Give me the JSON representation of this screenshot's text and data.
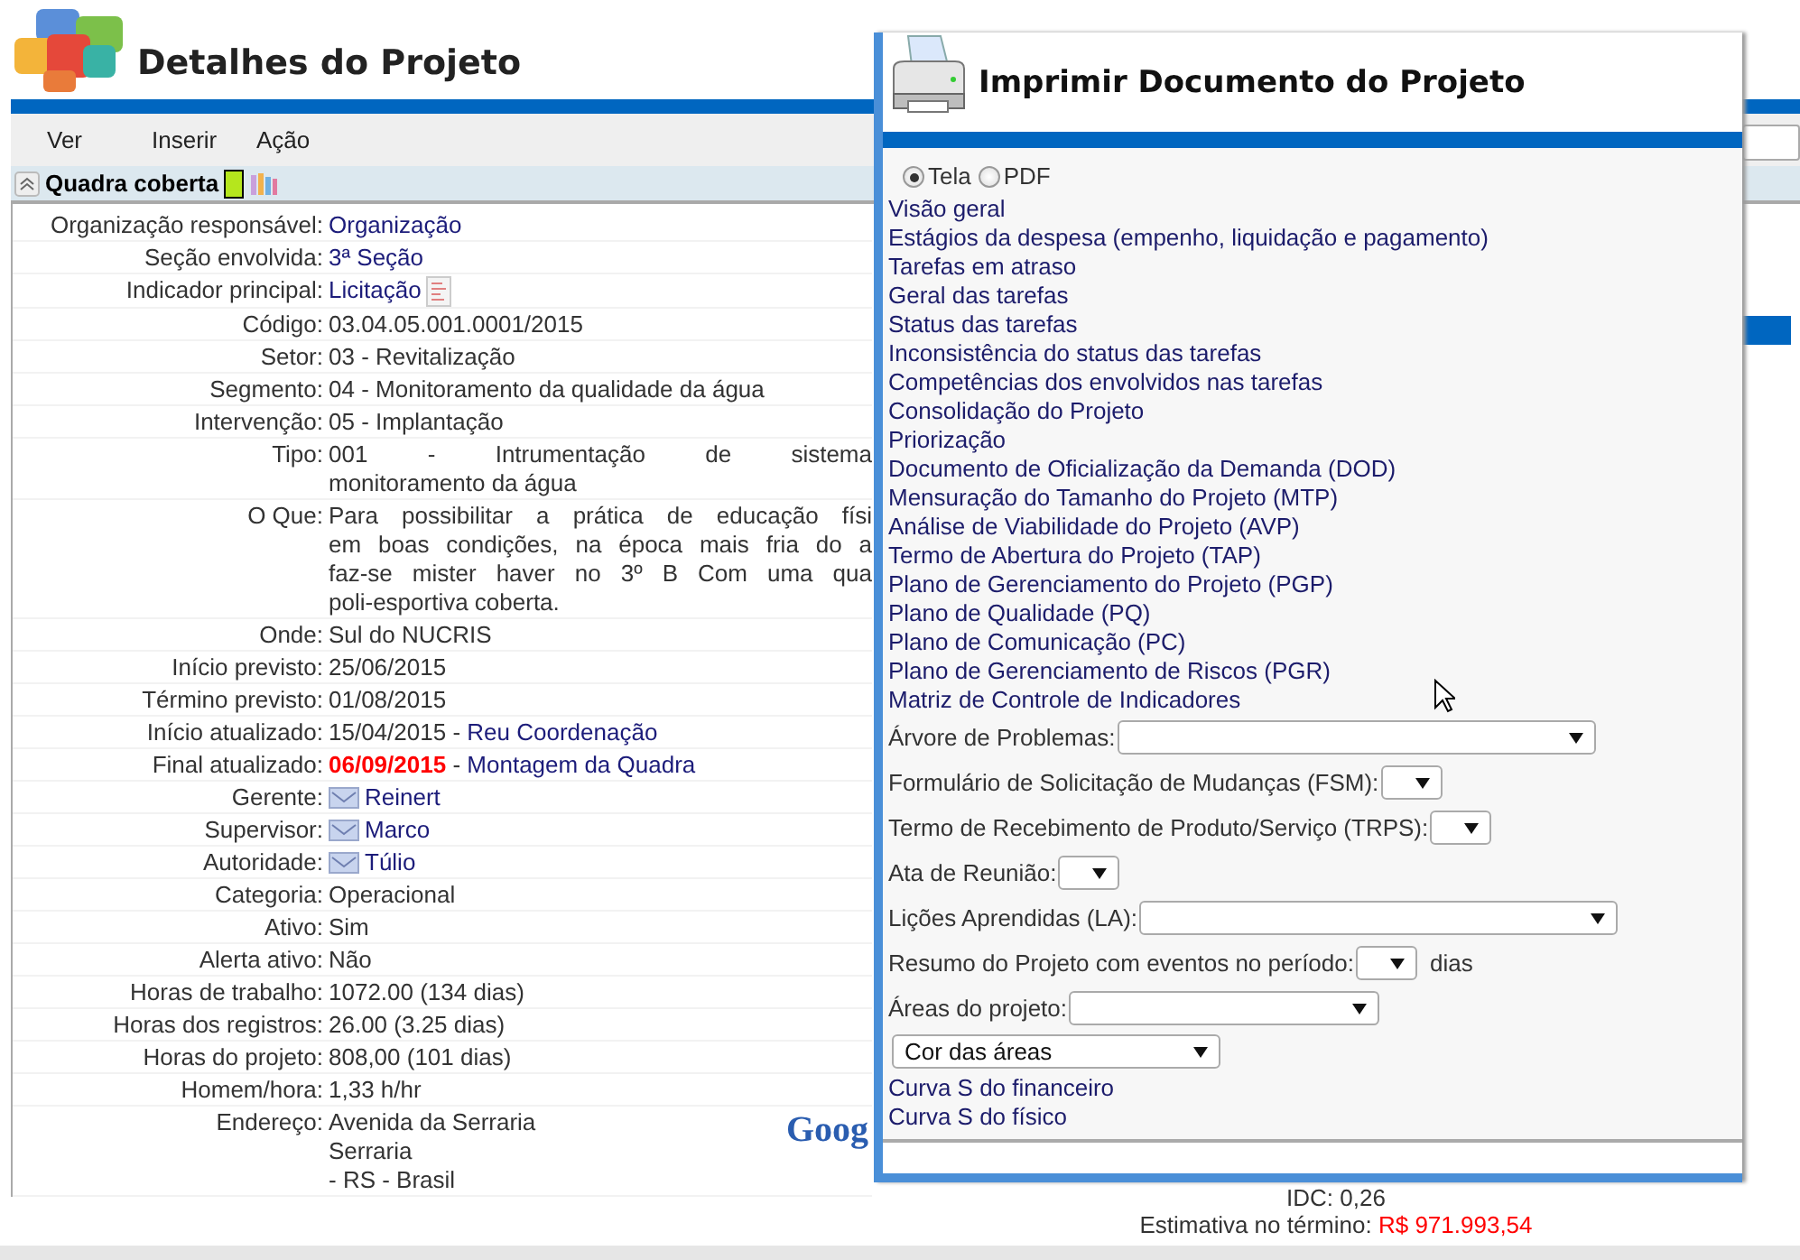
{
  "page_title": "Detalhes do Projeto",
  "menu": [
    "Ver",
    "Inserir",
    "Ação"
  ],
  "section": {
    "title": "Quadra coberta",
    "color": "#b5e61d"
  },
  "details": [
    {
      "label": "Organização responsável:",
      "kind": "link",
      "value": "Organização"
    },
    {
      "label": "Seção envolvida:",
      "kind": "link",
      "value": "3ª Seção"
    },
    {
      "label": "Indicador principal:",
      "kind": "link-doc",
      "value": "Licitação"
    },
    {
      "label": "Código:",
      "kind": "text",
      "value": "03.04.05.001.0001/2015"
    },
    {
      "label": "Setor:",
      "kind": "text",
      "value": "03 - Revitalização"
    },
    {
      "label": "Segmento:",
      "kind": "text",
      "value": "04 - Monitoramento da qualidade da água"
    },
    {
      "label": "Intervenção:",
      "kind": "text",
      "value": "05 - Implantação"
    },
    {
      "label": "Tipo:",
      "kind": "lines",
      "lines": [
        "001 - Intrumentação de sistema",
        "monitoramento da água"
      ]
    },
    {
      "label": "O Que:",
      "kind": "lines",
      "lines": [
        "Para possibilitar a prática de educação físi",
        "em boas condições, na época mais fria do a",
        "faz-se mister haver no 3º B Com uma qua",
        "poli-esportiva coberta."
      ]
    },
    {
      "label": "Onde:",
      "kind": "text",
      "value": "Sul do NUCRIS"
    },
    {
      "label": "Início previsto:",
      "kind": "text",
      "value": "25/06/2015"
    },
    {
      "label": "Término previsto:",
      "kind": "text",
      "value": "01/08/2015"
    },
    {
      "label": "Início atualizado:",
      "kind": "dated",
      "value": "15/04/2015",
      "overdue": false,
      "separator": "-",
      "note": "Reu Coordenação"
    },
    {
      "label": "Final atualizado:",
      "kind": "dated",
      "value": "06/09/2015",
      "overdue": true,
      "separator": "-",
      "note": "Montagem da Quadra"
    },
    {
      "label": "Gerente:",
      "kind": "person",
      "value": "Reinert"
    },
    {
      "label": "Supervisor:",
      "kind": "person",
      "value": "Marco"
    },
    {
      "label": "Autoridade:",
      "kind": "person",
      "value": "Túlio"
    },
    {
      "label": "Categoria:",
      "kind": "text",
      "value": "Operacional"
    },
    {
      "label": "Ativo:",
      "kind": "text",
      "value": "Sim"
    },
    {
      "label": "Alerta ativo:",
      "kind": "text",
      "value": "Não"
    },
    {
      "label": "Horas de trabalho:",
      "kind": "text",
      "value": "1072.00 (134 dias)"
    },
    {
      "label": "Horas dos registros:",
      "kind": "text",
      "value": "26.00 (3.25 dias)"
    },
    {
      "label": "Horas do projeto:",
      "kind": "text",
      "value": "808,00 (101 dias)"
    },
    {
      "label": "Homem/hora:",
      "kind": "text",
      "value": "1,33 h/hr"
    },
    {
      "label": "Endereço:",
      "kind": "address",
      "lines": [
        "Avenida da Serraria",
        "Serraria",
        "- RS - Brasil"
      ],
      "map_logo": "Goog"
    }
  ],
  "summary": {
    "idc_label": "IDC:",
    "idc_value": "0,26",
    "estimate_label": "Estimativa no término:",
    "estimate_value": "R$ 971.993,54"
  },
  "print_dialog": {
    "title": "Imprimir Documento do Projeto",
    "output_format": [
      {
        "label": "Tela",
        "selected": true
      },
      {
        "label": "PDF",
        "selected": false
      }
    ],
    "reports": [
      "Visão geral",
      "Estágios da despesa (empenho, liquidação e pagamento)",
      "Tarefas em atraso",
      "Geral das tarefas",
      "Status das tarefas",
      "Inconsistência do status das tarefas",
      "Competências dos envolvidos nas tarefas",
      "Consolidação do Projeto",
      "Priorização",
      "Documento de Oficialização da Demanda (DOD)",
      "Mensuração do Tamanho do Projeto (MTP)",
      "Análise de Viabilidade do Projeto (AVP)",
      "Termo de Abertura do Projeto (TAP)",
      "Plano de Gerenciamento do Projeto (PGP)",
      "Plano de Qualidade (PQ)",
      "Plano de Comunicação (PC)",
      "Plano de Gerenciamento de Riscos (PGR)",
      "Matriz de Controle de Indicadores"
    ],
    "form_rows": [
      {
        "label": "Árvore de Problemas:",
        "kind": "wide"
      },
      {
        "label": "Formulário de Solicitação de Mudanças (FSM):",
        "kind": "small"
      },
      {
        "label": "Termo de Recebimento de Produto/Serviço (TRPS):",
        "kind": "small"
      },
      {
        "label": "Ata de Reunião:",
        "kind": "small"
      },
      {
        "label": "Lições Aprendidas (LA):",
        "kind": "wide"
      },
      {
        "label": "Resumo do Projeto com eventos no período:",
        "kind": "small",
        "suffix": "dias"
      },
      {
        "label": "Áreas do projeto:",
        "kind": "medium"
      }
    ],
    "color_select": {
      "value": "Cor das áreas"
    },
    "curves": [
      "Curva S do financeiro",
      "Curva S do físico"
    ]
  }
}
